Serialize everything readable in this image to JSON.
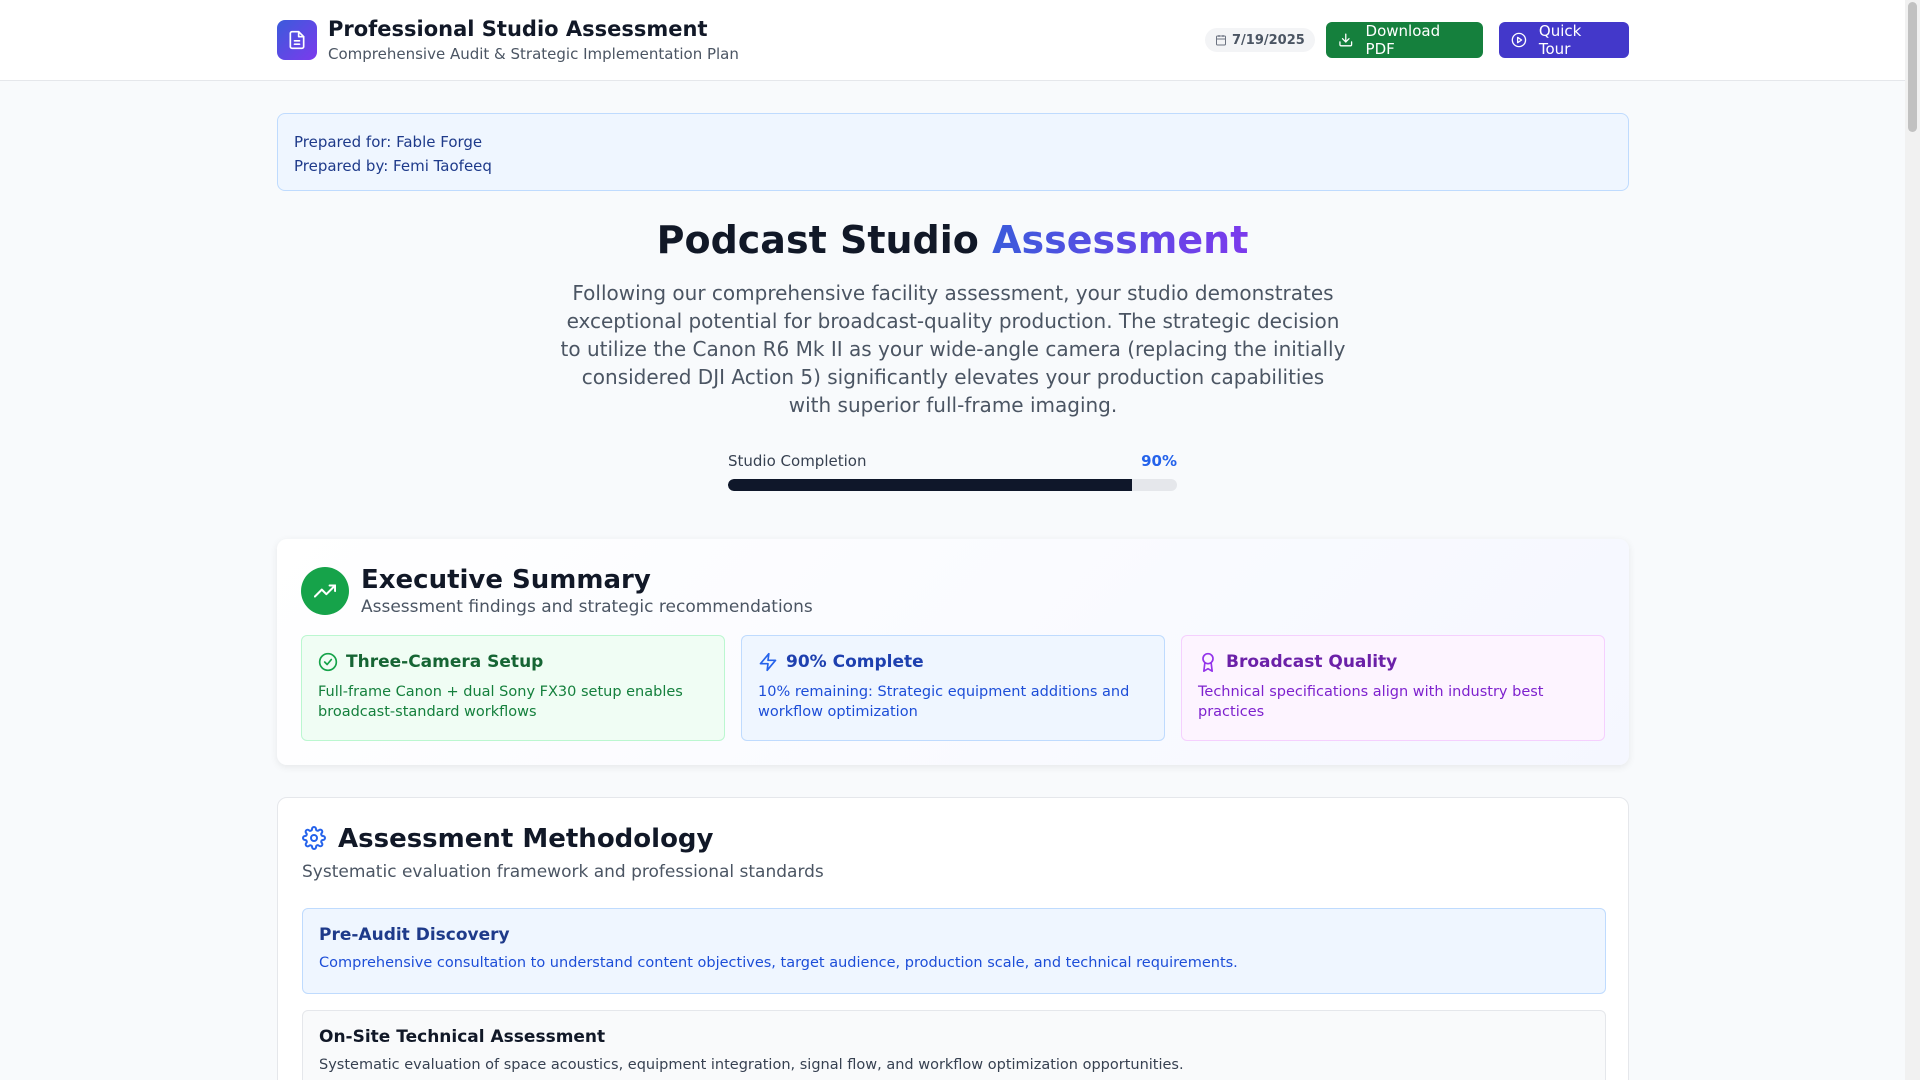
{
  "header": {
    "title": "Professional Studio Assessment",
    "subtitle": "Comprehensive Audit & Strategic Implementation Plan",
    "date": "7/19/2025",
    "download_label": "Download PDF",
    "tour_label": "Quick Tour"
  },
  "prepared": {
    "for": "Prepared for: Fable Forge",
    "by": "Prepared by: Femi Taofeeq"
  },
  "hero": {
    "title_main": "Podcast Studio",
    "title_accent": "Assessment",
    "paragraph": "Following our comprehensive facility assessment, your studio demonstrates exceptional potential for broadcast-quality production. The strategic decision to utilize the Canon R6 Mk II as your wide-angle camera (replacing the initially considered DJI Action 5) significantly elevates your production capabilities with superior full-frame imaging.",
    "progress_label": "Studio Completion",
    "progress_value_text": "90%",
    "progress_fraction": 0.9
  },
  "executive": {
    "title": "Executive Summary",
    "subtitle": "Assessment findings and strategic recommendations",
    "stats": [
      {
        "title": "Three-Camera Setup",
        "body": "Full-frame Canon + dual Sony FX30 setup enables broadcast-standard workflows",
        "icon": "check-circle-icon"
      },
      {
        "title": "90% Complete",
        "body": "10% remaining: Strategic equipment additions and workflow optimization",
        "icon": "lightning-icon"
      },
      {
        "title": "Broadcast Quality",
        "body": "Technical specifications align with industry best practices",
        "icon": "award-icon"
      }
    ]
  },
  "methodology": {
    "title": "Assessment Methodology",
    "subtitle": "Systematic evaluation framework and professional standards",
    "steps": [
      {
        "title": "Pre-Audit Discovery",
        "body": "Comprehensive consultation to understand content objectives, target audience, production scale, and technical requirements."
      },
      {
        "title": "On-Site Technical Assessment",
        "body": "Systematic evaluation of space acoustics, equipment integration, signal flow, and workflow optimization opportunities."
      }
    ]
  },
  "colors": {
    "accent_blue": "#3b5bdb",
    "accent_purple": "#7c3aed",
    "download_green": "#15803d",
    "tour_indigo": "#4338ca"
  }
}
